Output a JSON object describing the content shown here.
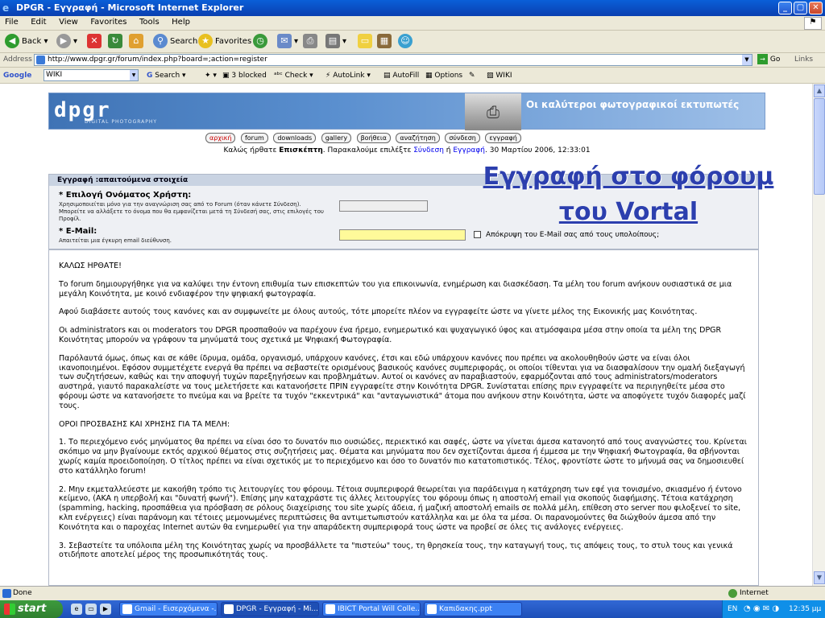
{
  "window": {
    "title": "DPGR - Εγγραφή - Microsoft Internet Explorer"
  },
  "menu": [
    "File",
    "Edit",
    "View",
    "Favorites",
    "Tools",
    "Help"
  ],
  "toolbar": {
    "back": "Back",
    "search": "Search",
    "favorites": "Favorites"
  },
  "address": {
    "label": "Address",
    "url": "http://www.dpgr.gr/forum/index.php?board=;action=register",
    "go": "Go",
    "links": "Links"
  },
  "google": {
    "label": "Google",
    "query": "WIKI",
    "search": "Search",
    "blocked": "3 blocked",
    "check": "Check",
    "autolink": "AutoLink",
    "autofill": "AutoFill",
    "options": "Options",
    "wiki": "WIKI"
  },
  "banner": {
    "logo": "dpgr",
    "logo_sub": "DIGITAL PHOTOGRAPHY",
    "tagline": "Οι καλύτεροι φωτογραφικοί εκτυπωτές"
  },
  "nav": [
    "αρχική",
    "forum",
    "downloads",
    "gallery",
    "βοήθεια",
    "αναζήτηση",
    "σύνδεση",
    "εγγραφή"
  ],
  "welcome": {
    "pre": "Καλώς ήρθατε ",
    "guest": "Επισκέπτη",
    "mid": ". Παρακαλούμε επιλέξτε ",
    "login": "Σύνδεση",
    "or": " ή ",
    "register": "Εγγραφή",
    "date": ". 30 Μαρτίου 2006, 12:33:01"
  },
  "form": {
    "header": "Εγγραφή :απαιτούμενα στοιχεία",
    "username_label": "* Επιλογή Ονόματος Χρήστη:",
    "username_desc": "Χρησιμοποιείται μόνο για την αναγνώριση σας από το Forum (όταν κάνετε Σύνδεση). Μπορείτε να αλλάξετε το όνομα που θα εμφανίζεται μετά τη Σύνδεσή σας, στις επιλογές του Προφίλ.",
    "email_label": "* E-Mail:",
    "email_desc": "Απαιτείται μια έγκυρη email διεύθυνση.",
    "hide_email": "Απόκρυψη του E-Mail σας από τους υπολοίπους;"
  },
  "overlay": {
    "line1": "Εγγραφή στο φόρουμ",
    "line2": "του Vortal"
  },
  "terms": [
    "ΚΑΛΩΣ ΗΡΘΑΤΕ!",
    "Το forum δημιουργήθηκε για να καλύψει την έντονη επιθυμία των επισκεπτών του για επικοινωνία, ενημέρωση και διασκέδαση. Τα μέλη του forum ανήκουν ουσιαστικά σε μια μεγάλη Κοινότητα, με κοινό ενδιαφέρον την ψηφιακή φωτογραφία.",
    "Αφού διαβάσετε αυτούς τους κανόνες και αν συμφωνείτε με όλους αυτούς, τότε μπορείτε πλέον να εγγραφείτε ώστε να γίνετε μέλος της Εικονικής μας Κοινότητας.",
    "Οι administrators και οι moderators του DPGR προσπαθούν να παρέχουν ένα ήρεμο, ενημερωτικό και ψυχαγωγικό ύφος και ατμόσφαιρα μέσα στην οποία τα μέλη της DPGR Κοινότητας μπορούν να γράφουν τα μηνύματά τους σχετικά με Ψηφιακή Φωτογραφία.",
    "Παρόλαυτά όμως, όπως και σε κάθε ίδρυμα, ομάδα, οργανισμό, υπάρχουν κανόνες, έτσι και εδώ υπάρχουν κανόνες που πρέπει να ακολουθηθούν ώστε να είναι όλοι ικανοποιημένοι. Εφόσον συμμετέχετε ενεργά θα πρέπει να σεβαστείτε ορισμένους βασικούς κανόνες συμπεριφοράς, οι οποίοι τίθενται για να διασφαλίσουν την ομαλή διεξαγωγή των συζητήσεων, καθώς και την αποφυγή τυχών παρεξηγήσεων και προβλημάτων. Αυτοί οι κανόνες αν παραβιαστούν, εφαρμόζονται από τους administrators/moderators αυστηρά, γιαυτό παρακαλείστε να τους μελετήσετε και κατανοήσετε ΠΡΙΝ εγγραφείτε στην Κοινότητα DPGR. Συνίσταται επίσης πριν εγγραφείτε να περιηγηθείτε μέσα στο φόρουμ ώστε να κατανοήσετε το πνεύμα και να βρείτε τα τυχόν \"εκκεντρικά\" και \"ανταγωνιστικά\" άτομα που ανήκουν στην Κοινότητα, ώστε να αποφύγετε τυχόν διαφορές μαζί τους.",
    "ΟΡΟΙ ΠΡΟΣΒΑΣΗΣ ΚΑΙ ΧΡΗΣΗΣ ΓΙΑ ΤΑ ΜΕΛΗ:",
    "1. Το περιεχόμενο ενός μηνύματος θα πρέπει να είναι όσο το δυνατόν πιο ουσιώδες, περιεκτικό και σαφές, ώστε να γίνεται άμεσα κατανοητό από τους αναγνώστες του. Κρίνεται σκόπιμο να μην βγαίνουμε εκτός αρχικού θέματος στις συζητήσεις μας. Θέματα και μηνύματα που δεν σχετίζονται άμεσα ή έμμεσα με την Ψηφιακή Φωτογραφία, θα σβήνονται χωρίς καμία προειδοποίηση. Ο τίτλος πρέπει να είναι σχετικός με το περιεχόμενο και όσο το δυνατόν πιο κατατοπιστικός. Τέλος, φροντίστε ώστε το μήνυμά σας να δημοσιευθεί στο κατάλληλο forum!",
    "2. Μην εκμεταλλεύεστε με κακοήθη τρόπο τις λειτουργίες του φόρουμ. Τέτοια συμπεριφορά θεωρείται για παράδειγμα η κατάχρηση των εφέ για τονισμένο, σκιασμένο ή έντονο κείμενο, (AKA η υπερβολή και \"δυνατή φωνή\"). Επίσης μην καταχράστε τις άλλες λειτουργίες του φόρουμ όπως η αποστολή email για σκοπούς διαφήμισης. Τέτοια κατάχρηση (spamming, hacking, προσπάθεια για πρόσβαση σε ρόλους διαχείρισης του site χωρίς άδεια, ή μαζική αποστολή emails σε πολλά μέλη, επίθεση στο server που φιλοξενεί το site, κλπ ενέργειες) είναι παράνομη και τέτοιες μεμονωμένες περιπτώσεις θα αντιμετωπιστούν κατάλληλα και με όλα τα μέσα. Οι παρανομούντες θα διώχθούν άμεσα από την Κοινότητα και ο παροχέας Internet αυτών θα ενημερωθεί για την απαράδεκτη συμπεριφορά τους ώστε να προβεί σε όλες τις ανάλογες ενέργειες.",
    "3. Σεβαστείτε τα υπόλοιπα μέλη της Κοινότητας χωρίς να προσβάλλετε τα \"πιστεύω\" τους, τη θρησκεία τους, την καταγωγή τους, τις απόψεις τους, το στυλ τους και γενικά οτιδήποτε αποτελεί μέρος της προσωπικότητάς τους."
  ],
  "status": {
    "text": "Done",
    "zone": "Internet"
  },
  "taskbar": {
    "start": "start",
    "tasks": [
      "Gmail - Εισερχόμενα -...",
      "DPGR - Εγγραφή - Mi...",
      "IBICT Portal Will Colle...",
      "Καπιδακης.ppt"
    ],
    "lang": "EN",
    "clock": "12:35 μμ"
  }
}
